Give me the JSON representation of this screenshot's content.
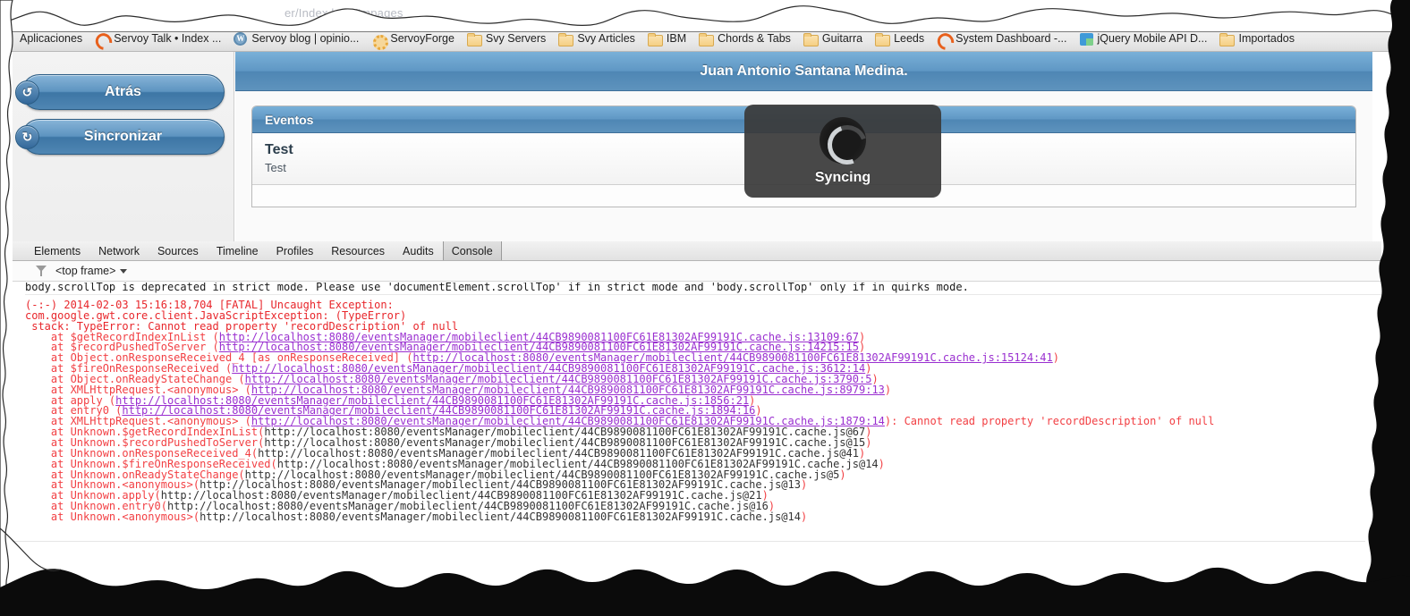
{
  "browser": {
    "url_ghost": "er/Index.html#mpages",
    "bookmarks": [
      {
        "label": "Aplicaciones",
        "icon": "none"
      },
      {
        "label": "Servoy Talk • Index ...",
        "icon": "servoy-icon"
      },
      {
        "label": "Servoy blog | opinio...",
        "icon": "wordpress-icon"
      },
      {
        "label": "ServoyForge",
        "icon": "gear-icon"
      },
      {
        "label": "Svy Servers",
        "icon": "folder-icon"
      },
      {
        "label": "Svy Articles",
        "icon": "folder-icon"
      },
      {
        "label": "IBM",
        "icon": "folder-icon"
      },
      {
        "label": "Chords & Tabs",
        "icon": "folder-icon"
      },
      {
        "label": "Guitarra",
        "icon": "folder-icon"
      },
      {
        "label": "Leeds",
        "icon": "folder-icon"
      },
      {
        "label": "System Dashboard -...",
        "icon": "servoy-icon"
      },
      {
        "label": "jQuery Mobile API D...",
        "icon": "jquery-icon"
      },
      {
        "label": "Importados",
        "icon": "folder-icon"
      }
    ]
  },
  "app": {
    "header_title": "Juan Antonio Santana Medina.",
    "buttons": {
      "back": {
        "label": "Atrás",
        "badge": "↺"
      },
      "sync": {
        "label": "Sincronizar",
        "badge": "↻"
      }
    },
    "listview": {
      "header": "Eventos",
      "items": [
        {
          "title": "Test",
          "subtitle": "Test"
        }
      ]
    },
    "overlay": {
      "label": "Syncing",
      "spinner": "loading-spinner-icon"
    },
    "colors": {
      "accent_blue": "#5f97c4",
      "accent_blue_dark": "#3e6f99",
      "overlay_bg": "#3a3a3a"
    }
  },
  "devtools": {
    "tabs": [
      {
        "label": "Elements",
        "active": false
      },
      {
        "label": "Network",
        "active": false
      },
      {
        "label": "Sources",
        "active": false
      },
      {
        "label": "Timeline",
        "active": false
      },
      {
        "label": "Profiles",
        "active": false
      },
      {
        "label": "Resources",
        "active": false
      },
      {
        "label": "Audits",
        "active": false
      },
      {
        "label": "Console",
        "active": true
      }
    ],
    "filterbar": {
      "filter_icon": "funnel-icon",
      "frame_selector": "<top frame>",
      "caret": "chevron-down-icon"
    },
    "console_lines": [
      {
        "kind": "warn",
        "text": "body.scrollTop is deprecated in strict mode. Please use 'documentElement.scrollTop' if in strict mode and 'body.scrollTop' only if in quirks mode."
      },
      {
        "kind": "err",
        "text": "(-:-) 2014-02-03 15:16:18,704 [FATAL] Uncaught Exception:"
      },
      {
        "kind": "err",
        "text": "com.google.gwt.core.client.JavaScriptException: (TypeError)"
      },
      {
        "kind": "err",
        "text": " stack: TypeError: Cannot read property 'recordDescription' of null"
      },
      {
        "kind": "err-link",
        "pre": "    at $getRecordIndexInList (",
        "link": "http://localhost:8080/eventsManager/mobileclient/44CB9890081100FC61E81302AF99191C.cache.js:13109:67",
        "post": ")"
      },
      {
        "kind": "err-link",
        "pre": "    at $recordPushedToServer (",
        "link": "http://localhost:8080/eventsManager/mobileclient/44CB9890081100FC61E81302AF99191C.cache.js:14215:15",
        "post": ")"
      },
      {
        "kind": "err-link",
        "pre": "    at Object.onResponseReceived_4 [as onResponseReceived] (",
        "link": "http://localhost:8080/eventsManager/mobileclient/44CB9890081100FC61E81302AF99191C.cache.js:15124:41",
        "post": ")"
      },
      {
        "kind": "err-link",
        "pre": "    at $fireOnResponseReceived (",
        "link": "http://localhost:8080/eventsManager/mobileclient/44CB9890081100FC61E81302AF99191C.cache.js:3612:14",
        "post": ")"
      },
      {
        "kind": "err-link",
        "pre": "    at Object.onReadyStateChange (",
        "link": "http://localhost:8080/eventsManager/mobileclient/44CB9890081100FC61E81302AF99191C.cache.js:3790:5",
        "post": ")"
      },
      {
        "kind": "err-link",
        "pre": "    at XMLHttpRequest.<anonymous> (",
        "link": "http://localhost:8080/eventsManager/mobileclient/44CB9890081100FC61E81302AF99191C.cache.js:8979:13",
        "post": ")"
      },
      {
        "kind": "err-link",
        "pre": "    at apply (",
        "link": "http://localhost:8080/eventsManager/mobileclient/44CB9890081100FC61E81302AF99191C.cache.js:1856:21",
        "post": ")"
      },
      {
        "kind": "err-link",
        "pre": "    at entry0 (",
        "link": "http://localhost:8080/eventsManager/mobileclient/44CB9890081100FC61E81302AF99191C.cache.js:1894:16",
        "post": ")"
      },
      {
        "kind": "err-link",
        "pre": "    at XMLHttpRequest.<anonymous> (",
        "link": "http://localhost:8080/eventsManager/mobileclient/44CB9890081100FC61E81302AF99191C.cache.js:1879:14",
        "post": "): Cannot read property 'recordDescription' of null"
      },
      {
        "kind": "err-plain",
        "pre": "    at Unknown.$getRecordIndexInList(",
        "link": "http://localhost:8080/eventsManager/mobileclient/44CB9890081100FC61E81302AF99191C.cache.js@67",
        "post": ")"
      },
      {
        "kind": "err-plain",
        "pre": "    at Unknown.$recordPushedToServer(",
        "link": "http://localhost:8080/eventsManager/mobileclient/44CB9890081100FC61E81302AF99191C.cache.js@15",
        "post": ")"
      },
      {
        "kind": "err-plain",
        "pre": "    at Unknown.onResponseReceived_4(",
        "link": "http://localhost:8080/eventsManager/mobileclient/44CB9890081100FC61E81302AF99191C.cache.js@41",
        "post": ")"
      },
      {
        "kind": "err-plain",
        "pre": "    at Unknown.$fireOnResponseReceived(",
        "link": "http://localhost:8080/eventsManager/mobileclient/44CB9890081100FC61E81302AF99191C.cache.js@14",
        "post": ")"
      },
      {
        "kind": "err-plain",
        "pre": "    at Unknown.onReadyStateChange(",
        "link": "http://localhost:8080/eventsManager/mobileclient/44CB9890081100FC61E81302AF99191C.cache.js@5",
        "post": ")"
      },
      {
        "kind": "err-plain",
        "pre": "    at Unknown.<anonymous>(",
        "link": "http://localhost:8080/eventsManager/mobileclient/44CB9890081100FC61E81302AF99191C.cache.js@13",
        "post": ")"
      },
      {
        "kind": "err-plain",
        "pre": "    at Unknown.apply(",
        "link": "http://localhost:8080/eventsManager/mobileclient/44CB9890081100FC61E81302AF99191C.cache.js@21",
        "post": ")"
      },
      {
        "kind": "err-plain",
        "pre": "    at Unknown.entry0(",
        "link": "http://localhost:8080/eventsManager/mobileclient/44CB9890081100FC61E81302AF99191C.cache.js@16",
        "post": ")"
      },
      {
        "kind": "err-plain",
        "pre": "    at Unknown.<anonymous>(",
        "link": "http://localhost:8080/eventsManager/mobileclient/44CB9890081100FC61E81302AF99191C.cache.js@14",
        "post": ")"
      }
    ]
  }
}
